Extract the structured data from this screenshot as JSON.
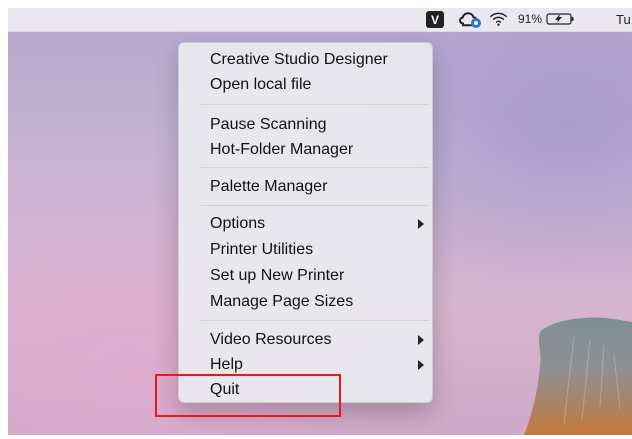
{
  "menubar": {
    "app_status_letter": "V",
    "creative_cloud_icon": "creative-cloud-icon",
    "wifi_icon": "wifi-icon",
    "battery_percent": "91%",
    "battery_icon": "battery-charging-icon",
    "day_label": "Tu"
  },
  "menu": {
    "items": [
      {
        "label": "Creative Studio Designer"
      },
      {
        "label": "Open local file"
      },
      {
        "label": "Pause Scanning"
      },
      {
        "label": "Hot-Folder Manager"
      },
      {
        "label": "Palette Manager"
      },
      {
        "label": "Options",
        "submenu": true
      },
      {
        "label": "Printer Utilities"
      },
      {
        "label": "Set up New Printer"
      },
      {
        "label": "Manage Page Sizes"
      },
      {
        "label": "Video Resources",
        "submenu": true
      },
      {
        "label": "Help",
        "submenu": true
      },
      {
        "label": "Quit"
      }
    ]
  },
  "annotation": {
    "highlight_color": "#e51919"
  },
  "colors": {
    "menubar_bg": "#ece9f0",
    "menu_bg": "#e9e8ee",
    "wallpaper_pink": "#d7b4cf",
    "wallpaper_lavender": "#b4a7cf"
  }
}
